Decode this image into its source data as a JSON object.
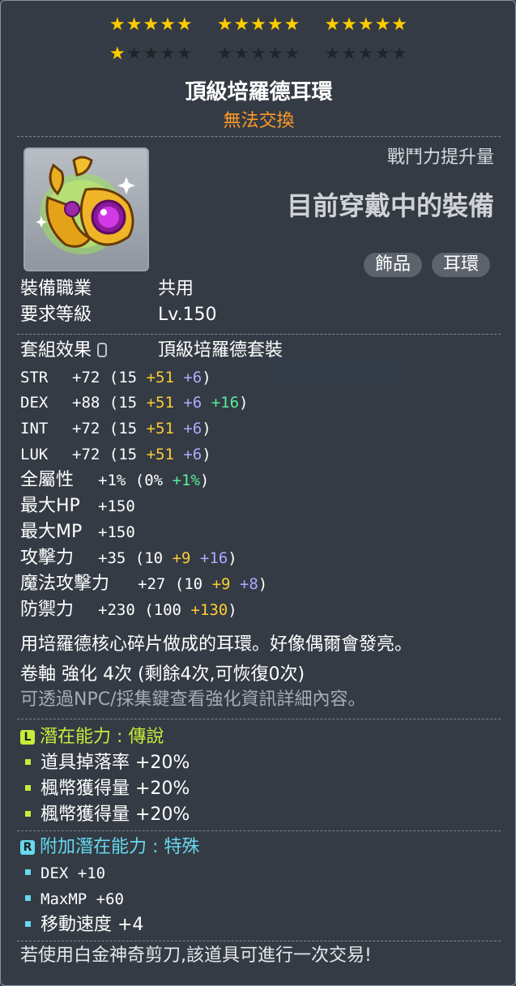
{
  "stars": {
    "rows": [
      [
        5,
        5,
        5
      ],
      [
        1,
        0,
        0
      ]
    ],
    "per_group": 5
  },
  "item": {
    "name": "頂級培羅德耳環",
    "trade_status": "無法交換",
    "combat_power_label": "戰鬥力提升量",
    "equipped_label": "目前穿戴中的裝備",
    "tags": [
      "飾品",
      "耳環"
    ],
    "icon": "gold-purple-earring-icon"
  },
  "requirements": {
    "job_label": "裝備職業",
    "job_value": "共用",
    "level_label": "要求等級",
    "level_value": "Lv.150"
  },
  "set": {
    "label": "套組效果",
    "value": "頂級培羅德套裝"
  },
  "stats": [
    {
      "name": "STR",
      "total": "+72",
      "base": "15",
      "scroll": "+51",
      "star": "+6",
      "extra": ""
    },
    {
      "name": "DEX",
      "total": "+88",
      "base": "15",
      "scroll": "+51",
      "star": "+6",
      "extra": "+16"
    },
    {
      "name": "INT",
      "total": "+72",
      "base": "15",
      "scroll": "+51",
      "star": "+6",
      "extra": ""
    },
    {
      "name": "LUK",
      "total": "+72",
      "base": "15",
      "scroll": "+51",
      "star": "+6",
      "extra": ""
    }
  ],
  "all_stat": {
    "name": "全屬性",
    "total": "+1%",
    "base": "0%",
    "extra": "+1%"
  },
  "max_hp": {
    "name": "最大HP",
    "total": "+150"
  },
  "max_mp": {
    "name": "最大MP",
    "total": "+150"
  },
  "attack": {
    "name": "攻擊力",
    "total": "+35",
    "base": "10",
    "scroll": "+9",
    "star": "+16"
  },
  "magic_attack": {
    "name": "魔法攻擊力",
    "total": "+27",
    "base": "10",
    "scroll": "+9",
    "star": "+8"
  },
  "defense": {
    "name": "防禦力",
    "total": "+230",
    "base": "100",
    "scroll": "+130"
  },
  "description": "用培羅德核心碎片做成的耳環。好像偶爾會發亮。",
  "enhance": {
    "line": "卷軸 強化 4次 (剩餘4次,可恢復0次)",
    "hint": "可透過NPC/採集鍵查看強化資訊詳細內容。"
  },
  "potential": {
    "badge": "L",
    "label": "潛在能力 : 傳說",
    "color": "#c8ec3a",
    "lines": [
      "道具掉落率 +20%",
      "楓幣獲得量 +20%",
      "楓幣獲得量 +20%"
    ]
  },
  "additional_potential": {
    "badge": "R",
    "label": "附加潛在能力 : 特殊",
    "color": "#66d8f0",
    "lines": [
      "DEX +10",
      "MaxMP +60",
      "移動速度 +4"
    ]
  },
  "footer": "若使用白金神奇剪刀,該道具可進行一次交易!"
}
